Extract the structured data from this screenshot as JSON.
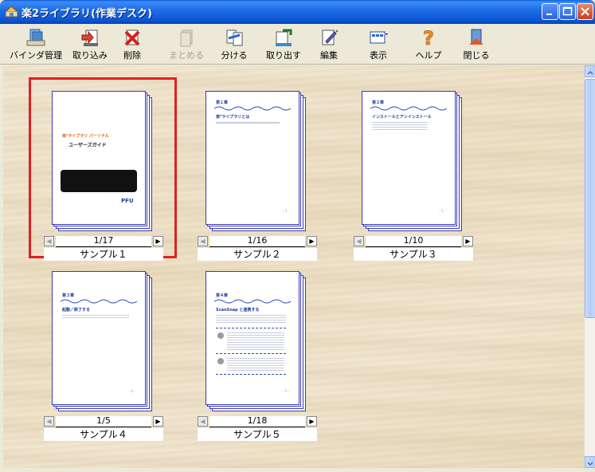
{
  "window": {
    "title": "楽2ライブラリ(作業デスク)"
  },
  "toolbar": {
    "buttons": [
      {
        "label": "バインダ管理",
        "icon": "binder-icon",
        "enabled": true
      },
      {
        "label": "取り込み",
        "icon": "import-icon",
        "enabled": true
      },
      {
        "label": "削除",
        "icon": "delete-icon",
        "enabled": true
      },
      {
        "label": "まとめる",
        "icon": "merge-icon",
        "enabled": false
      },
      {
        "label": "分ける",
        "icon": "split-icon",
        "enabled": true
      },
      {
        "label": "取り出す",
        "icon": "export-icon",
        "enabled": true
      },
      {
        "label": "編集",
        "icon": "edit-icon",
        "enabled": true
      },
      {
        "label": "表示",
        "icon": "view-icon",
        "enabled": true
      },
      {
        "label": "ヘルプ",
        "icon": "help-icon",
        "enabled": true
      },
      {
        "label": "閉じる",
        "icon": "close-door-icon",
        "enabled": true
      }
    ]
  },
  "documents": [
    {
      "name": "サンプル１",
      "page": "1/17",
      "selected": true,
      "cover": {
        "brand": "楽²ライブラリ パーソナル",
        "title": "ユーザーズガイド",
        "logo": "PFU"
      }
    },
    {
      "name": "サンプル２",
      "page": "1/16",
      "selected": false,
      "cover": {
        "chapter": "第１章",
        "heading": "楽²ライブラリとは"
      }
    },
    {
      "name": "サンプル３",
      "page": "1/10",
      "selected": false,
      "cover": {
        "chapter": "第２章",
        "heading": "インストールとアンインストール"
      }
    },
    {
      "name": "サンプル４",
      "page": "1/5",
      "selected": false,
      "cover": {
        "chapter": "第３章",
        "heading": "起動／終了する"
      }
    },
    {
      "name": "サンプル５",
      "page": "1/18",
      "selected": false,
      "cover": {
        "chapter": "第４章",
        "heading": "ScanSnap と連携する"
      }
    }
  ],
  "colors": {
    "titlebar": "#0b55d4",
    "selection": "#e02020",
    "page_border": "#3a3ab8"
  }
}
